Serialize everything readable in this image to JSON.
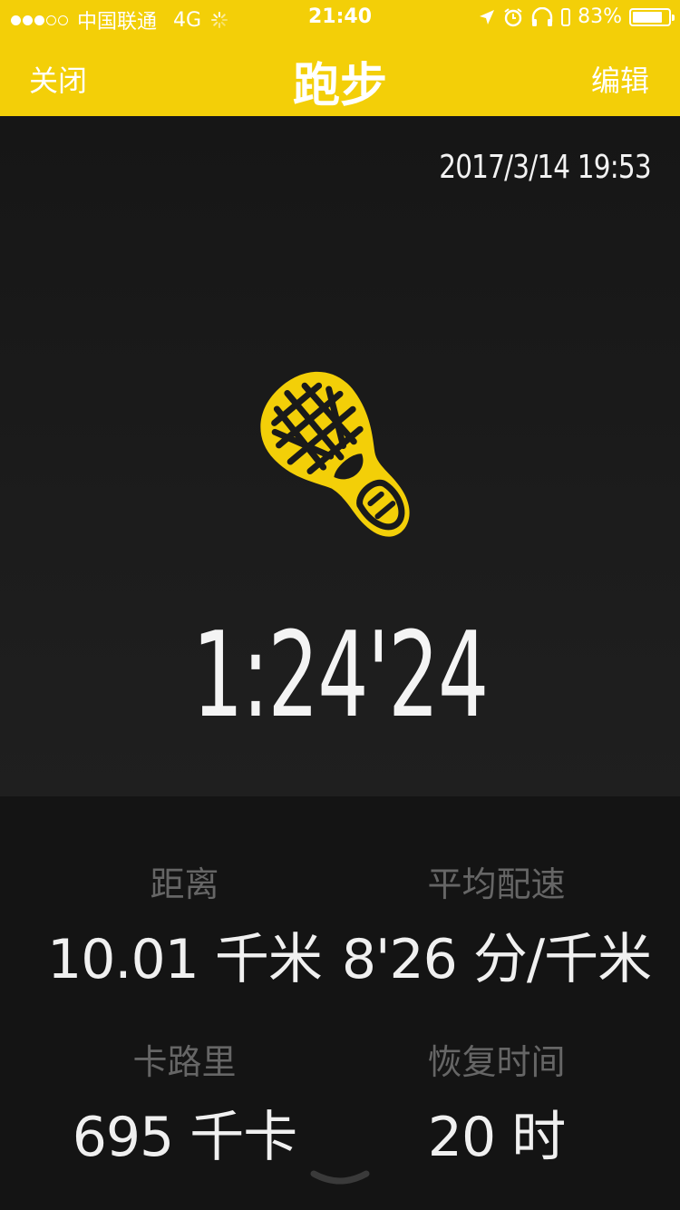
{
  "status_bar": {
    "carrier": "中国联通",
    "network": "4G",
    "time": "21:40",
    "battery_percent": "83%",
    "battery_level": 0.83,
    "signal_bars_filled": 3,
    "signal_bars_total": 5,
    "icons": [
      "location-arrow-icon",
      "alarm-icon",
      "headphones-icon",
      "battery-icon"
    ]
  },
  "nav": {
    "close_label": "关闭",
    "title": "跑步",
    "edit_label": "编辑"
  },
  "activity": {
    "datetime": "2017/3/14 19:53",
    "icon": "running-shoe-icon",
    "duration": "1:24'24"
  },
  "stats": [
    {
      "label": "距离",
      "value": "10.01 千米"
    },
    {
      "label": "平均配速",
      "value": "8'26 分/千米"
    },
    {
      "label": "卡路里",
      "value": "695 千卡"
    },
    {
      "label": "恢复时间",
      "value": "20 时"
    }
  ],
  "colors": {
    "accent": "#f3cf08",
    "background": "#141414",
    "label_gray": "#666666"
  }
}
